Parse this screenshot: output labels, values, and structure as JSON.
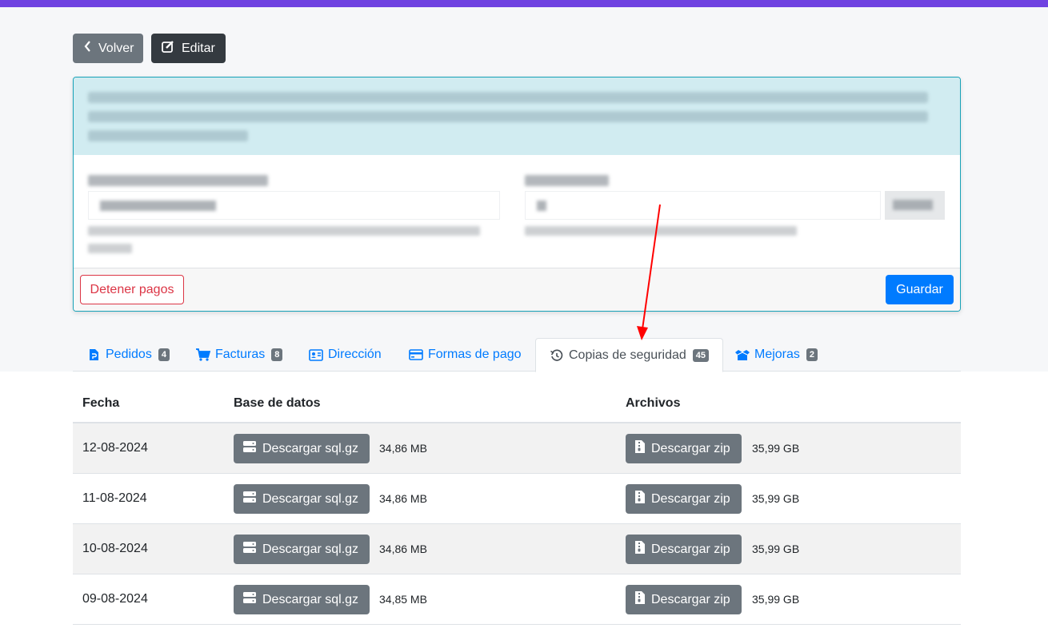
{
  "header": {
    "back_label": "Volver",
    "edit_label": "Editar"
  },
  "card": {
    "stop_payments_label": "Detener pagos",
    "save_label": "Guardar"
  },
  "tabs": [
    {
      "label": "Pedidos",
      "badge": "4",
      "icon": "file-icon"
    },
    {
      "label": "Facturas",
      "badge": "8",
      "icon": "cart-icon"
    },
    {
      "label": "Dirección",
      "badge": null,
      "icon": "address-card-icon"
    },
    {
      "label": "Formas de pago",
      "badge": null,
      "icon": "credit-card-icon"
    },
    {
      "label": "Copias de seguridad",
      "badge": "45",
      "icon": "history-icon"
    },
    {
      "label": "Mejoras",
      "badge": "2",
      "icon": "box-open-icon"
    }
  ],
  "table": {
    "columns": [
      "Fecha",
      "Base de datos",
      "Archivos"
    ],
    "sql_button_label": "Descargar sql.gz",
    "zip_button_label": "Descargar zip",
    "rows": [
      {
        "date": "12-08-2024",
        "sql_size": "34,86 MB",
        "zip_size": "35,99 GB"
      },
      {
        "date": "11-08-2024",
        "sql_size": "34,86 MB",
        "zip_size": "35,99 GB"
      },
      {
        "date": "10-08-2024",
        "sql_size": "34,86 MB",
        "zip_size": "35,99 GB"
      },
      {
        "date": "09-08-2024",
        "sql_size": "34,85 MB",
        "zip_size": "35,99 GB"
      }
    ]
  },
  "colors": {
    "top_bar": "#6f42e1",
    "primary": "#007bff",
    "secondary": "#6c757d",
    "danger": "#dc3545",
    "info_border": "#17a2b8",
    "annotation_arrow": "#ff0000"
  }
}
